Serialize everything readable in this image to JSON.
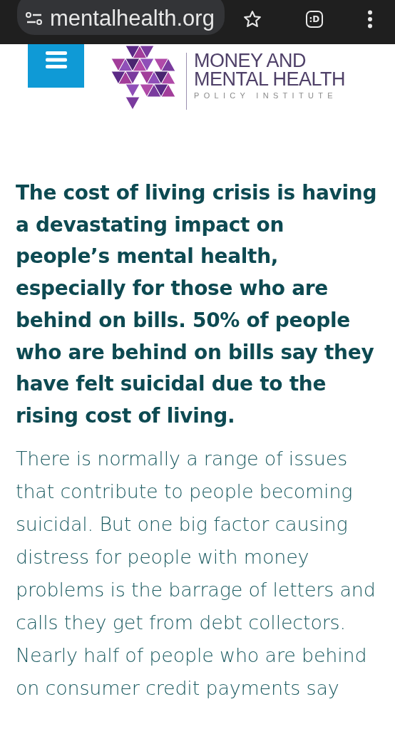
{
  "browser": {
    "url": "mentalhealth.org",
    "tab_count": ":D"
  },
  "header": {
    "logo_lines": [
      "MONEY AND",
      "MENTAL HEALTH",
      "POLICY INSTITUTE"
    ]
  },
  "article": {
    "heading": "The cost of living crisis is having a devastating impact on people’s mental health, especially for those who are behind on bills. 50% of people who are behind on bills say they have felt suicidal due to the rising cost of living.",
    "paragraph": "There is normally a range of issues that contribute to people becoming suicidal. But one big factor causing distress for people with money problems is the barrage of letters and calls they get from debt collectors. Nearly half of people who are behind on consumer credit payments say"
  }
}
